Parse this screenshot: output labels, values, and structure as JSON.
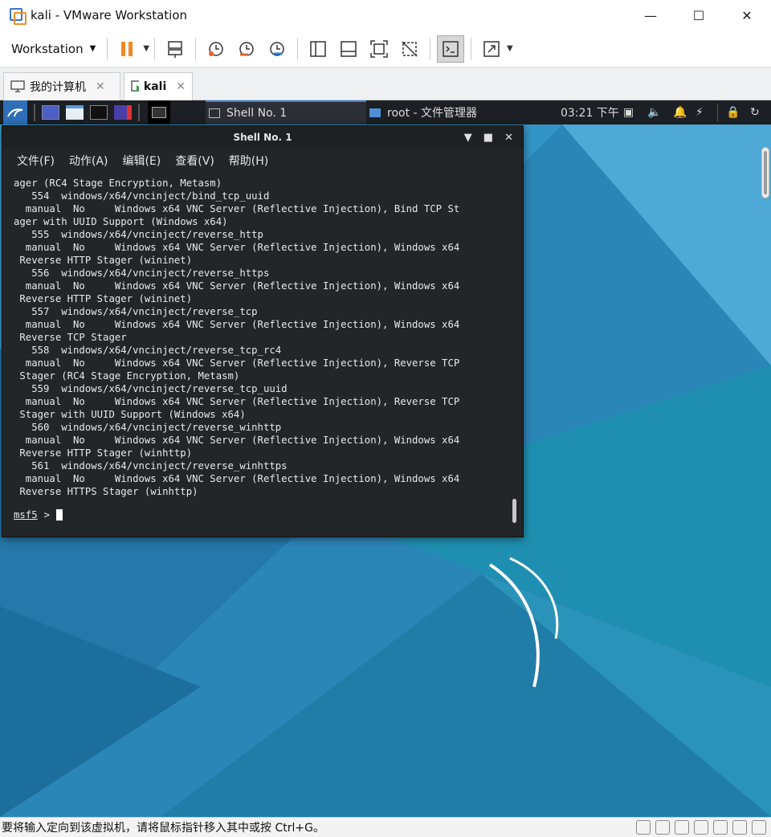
{
  "window": {
    "title": "kali - VMware Workstation"
  },
  "toolbar": {
    "menu_label": "Workstation"
  },
  "tabs": [
    {
      "label": "我的计算机"
    },
    {
      "label": "kali"
    }
  ],
  "guest_panel": {
    "taskbar_items": [
      {
        "label": "Shell No. 1"
      },
      {
        "label": "root - 文件管理器"
      }
    ],
    "clock": "03:21 下午"
  },
  "terminal": {
    "window_title": "Shell No. 1",
    "menu": [
      "文件(F)",
      "动作(A)",
      "编辑(E)",
      "查看(V)",
      "帮助(H)"
    ],
    "lines": [
      "ager (RC4 Stage Encryption, Metasm)",
      "   554  windows/x64/vncinject/bind_tcp_uuid",
      "  manual  No     Windows x64 VNC Server (Reflective Injection), Bind TCP St",
      "ager with UUID Support (Windows x64)",
      "   555  windows/x64/vncinject/reverse_http",
      "  manual  No     Windows x64 VNC Server (Reflective Injection), Windows x64",
      " Reverse HTTP Stager (wininet)",
      "   556  windows/x64/vncinject/reverse_https",
      "  manual  No     Windows x64 VNC Server (Reflective Injection), Windows x64",
      " Reverse HTTP Stager (wininet)",
      "   557  windows/x64/vncinject/reverse_tcp",
      "  manual  No     Windows x64 VNC Server (Reflective Injection), Windows x64",
      " Reverse TCP Stager",
      "   558  windows/x64/vncinject/reverse_tcp_rc4",
      "  manual  No     Windows x64 VNC Server (Reflective Injection), Reverse TCP",
      " Stager (RC4 Stage Encryption, Metasm)",
      "   559  windows/x64/vncinject/reverse_tcp_uuid",
      "  manual  No     Windows x64 VNC Server (Reflective Injection), Reverse TCP",
      " Stager with UUID Support (Windows x64)",
      "   560  windows/x64/vncinject/reverse_winhttp",
      "  manual  No     Windows x64 VNC Server (Reflective Injection), Windows x64",
      " Reverse HTTP Stager (winhttp)",
      "   561  windows/x64/vncinject/reverse_winhttps",
      "  manual  No     Windows x64 VNC Server (Reflective Injection), Windows x64",
      " Reverse HTTPS Stager (winhttp)"
    ],
    "prompt": "msf5",
    "prompt_symbol": ">"
  },
  "statusbar": {
    "message": "要将输入定向到该虚拟机，请将鼠标指针移入其中或按 Ctrl+G。"
  },
  "colors": {
    "desktop": "#2a7fb0",
    "terminal_bg": "#232629",
    "panel_bg": "#1c1f24",
    "pause_orange": "#f08a24"
  }
}
